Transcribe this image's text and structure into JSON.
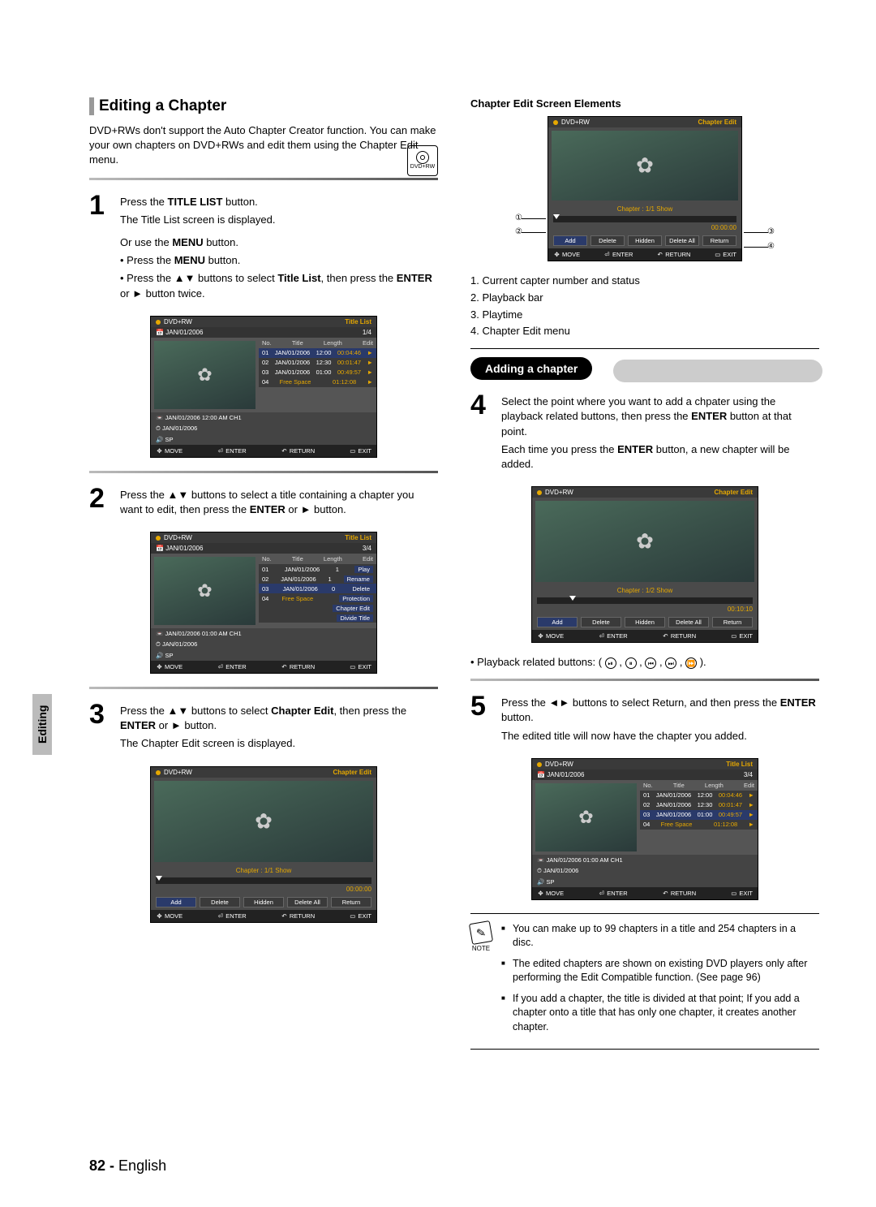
{
  "side_tab": "Editing",
  "page_footer": {
    "page": "82 -",
    "lang": "English"
  },
  "section_title": "Editing a Chapter",
  "intro": "DVD+RWs don't support the Auto Chapter Creator function. You can make your own chapters on DVD+RWs and edit them using the Chapter Edit menu.",
  "disc_icon_label": "DVD+RW",
  "step1": {
    "line1_pre": "Press the ",
    "line1_bold": "TITLE LIST",
    "line1_post": " button.",
    "line2": "The Title List screen is displayed.",
    "line3_pre": "Or use the ",
    "line3_bold": "MENU",
    "line3_post": " button.",
    "b1_pre": "Press the ",
    "b1_bold": "MENU",
    "b1_post": " button.",
    "b2_pre": "Press the ▲▼ buttons to select ",
    "b2_bold": "Title List",
    "b2_post": ", then press the ",
    "b2_bold2": "ENTER",
    "b2_post2": " or ► button twice."
  },
  "step2": {
    "pre": "Press the ▲▼ buttons to select a title containing a chapter you want to edit, then press the ",
    "bold": "ENTER",
    "post": " or ► button."
  },
  "step3": {
    "pre": "Press the ▲▼ buttons to select ",
    "bold": "Chapter Edit",
    "post": ", then press the ",
    "bold2": "ENTER",
    "post2": " or ► button.",
    "line2": "The Chapter Edit screen is displayed."
  },
  "right_heading": "Chapter Edit Screen Elements",
  "callouts": {
    "c1": "①",
    "c2": "②",
    "c3": "③",
    "c4": "④"
  },
  "elements_list": {
    "i1": "1. Current capter number and status",
    "i2": "2. Playback bar",
    "i3": "3. Playtime",
    "i4": "4. Chapter Edit menu"
  },
  "adding_title": "Adding a chapter",
  "step4": {
    "line1": "Select the point where you want to add a chpater using the playback related buttons, then press the ",
    "bold": "ENTER",
    "post": " button at that point.",
    "line2_pre": "Each time you press the ",
    "line2_bold": "ENTER",
    "line2_post": " button, a new chapter will be added."
  },
  "playback_text": "• Playback related buttons: (",
  "playback_end": ").",
  "step5": {
    "line1_pre": "Press the ◄► buttons to select Return, and then press the ",
    "line1_bold": "ENTER",
    "line1_post": " button.",
    "line2": "The edited title will now have the chapter you added."
  },
  "notes": {
    "label": "NOTE",
    "n1": "You can make up to 99 chapters in a title and 254 chapters in a disc.",
    "n2": "The edited chapters are shown on existing DVD players only after performing the Edit Compatible function. (See page 96)",
    "n3": "If you add a chapter, the title is divided at that point; If you add a chapter onto a title that has only one chapter, it creates another chapter."
  },
  "screen_common": {
    "disc": "DVD+RW",
    "title_list": "Title List",
    "chapter_edit": "Chapter Edit",
    "date": "JAN/01/2006",
    "nav": {
      "move": "MOVE",
      "enter": "ENTER",
      "return": "RETURN",
      "exit": "EXIT"
    }
  },
  "screen1": {
    "counter": "1/4",
    "cols": {
      "no": "No.",
      "title": "Title",
      "length": "Length",
      "edit": "Edit"
    },
    "rows": [
      {
        "no": "01",
        "title": "JAN/01/2006",
        "t": "12:00",
        "len": "00:04:46",
        "arrow": "►"
      },
      {
        "no": "02",
        "title": "JAN/01/2006",
        "t": "12:30",
        "len": "00:01:47",
        "arrow": "►"
      },
      {
        "no": "03",
        "title": "JAN/01/2006",
        "t": "01:00",
        "len": "00:49:57",
        "arrow": "►"
      },
      {
        "no": "04",
        "title": "Free Space",
        "t": "",
        "len": "01:12:08",
        "arrow": "►"
      }
    ],
    "meta1": "JAN/01/2006 12:00 AM CH1",
    "meta2": "JAN/01/2006",
    "meta3": "SP"
  },
  "screen2": {
    "counter": "3/4",
    "cols": {
      "no": "No.",
      "title": "Title",
      "length": "Length",
      "edit": "Edit"
    },
    "rows": [
      {
        "no": "01",
        "title": "JAN/01/2006",
        "t": "1",
        "opt": "Play"
      },
      {
        "no": "02",
        "title": "JAN/01/2006",
        "t": "1",
        "opt": "Rename"
      },
      {
        "no": "03",
        "title": "JAN/01/2006",
        "t": "0",
        "opt": "Delete"
      },
      {
        "no": "04",
        "title": "Free Space",
        "t": "",
        "opt": "Protection"
      }
    ],
    "opts_extra": [
      "Chapter Edit",
      "Divide Title"
    ],
    "meta1": "JAN/01/2006 01:00 AM CH1",
    "meta2": "JAN/01/2006",
    "meta3": "SP"
  },
  "screen3": {
    "caption": "Chapter : 1/1 Show",
    "time": "00:00:00",
    "buttons": [
      "Add",
      "Delete",
      "Hidden",
      "Delete All",
      "Return"
    ]
  },
  "screen4": {
    "caption": "Chapter : 1/1 Show",
    "time": "00:00:00",
    "buttons": [
      "Add",
      "Delete",
      "Hidden",
      "Delete All",
      "Return"
    ]
  },
  "screen5": {
    "caption": "Chapter : 1/2 Show",
    "time": "00:10:10",
    "buttons": [
      "Add",
      "Delete",
      "Hidden",
      "Delete All",
      "Return"
    ]
  },
  "screen6": {
    "counter": "3/4",
    "cols": {
      "no": "No.",
      "title": "Title",
      "length": "Length",
      "edit": "Edit"
    },
    "rows": [
      {
        "no": "01",
        "title": "JAN/01/2006",
        "t": "12:00",
        "len": "00:04:46",
        "arrow": "►"
      },
      {
        "no": "02",
        "title": "JAN/01/2006",
        "t": "12:30",
        "len": "00:01:47",
        "arrow": "►"
      },
      {
        "no": "03",
        "title": "JAN/01/2006",
        "t": "01:00",
        "len": "00:49:57",
        "arrow": "►"
      },
      {
        "no": "04",
        "title": "Free Space",
        "t": "",
        "len": "01:12:08",
        "arrow": "►"
      }
    ],
    "meta1": "JAN/01/2006 01:00 AM CH1",
    "meta2": "JAN/01/2006",
    "meta3": "SP"
  }
}
